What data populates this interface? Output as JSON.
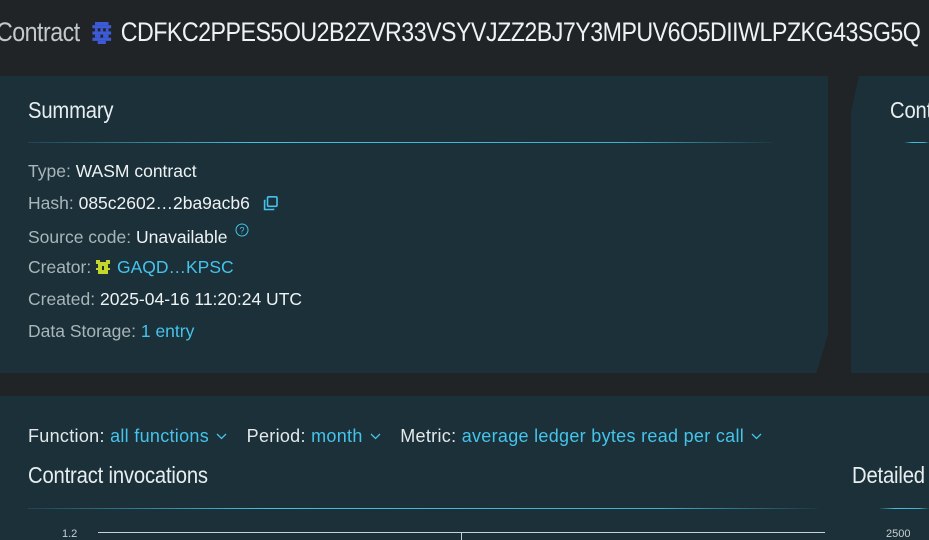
{
  "page_title": {
    "prefix": "Contract",
    "contract_id": "CDFKC2PPES5OU2B2ZVR33VSYVJZZ2BJ7Y3MPUV6O5DIIWLPZKG43SG5Q"
  },
  "summary": {
    "title": "Summary",
    "rows": [
      {
        "label": "Type:",
        "value": "WASM contract"
      },
      {
        "label": "Hash:",
        "value": "085c2602…2ba9acb6"
      },
      {
        "label": "Source code:",
        "value": "Unavailable"
      },
      {
        "label": "Creator:",
        "value": "GAQD…KPSC"
      },
      {
        "label": "Created:",
        "value": "2025-04-16 11:20:24 UTC"
      },
      {
        "label": "Data Storage:",
        "value": "1 entry"
      }
    ]
  },
  "side_panel": {
    "title": "Cont"
  },
  "filters": {
    "function_label": "Function:",
    "function_value": "all functions",
    "period_label": "Period:",
    "period_value": "month",
    "metric_label": "Metric:",
    "metric_value": "average ledger bytes read per call"
  },
  "invocations": {
    "title": "Contract invocations",
    "detailed_title": "Detailed"
  },
  "chart_data": {
    "type": "line",
    "title": "",
    "y_ticks_left": [
      "1.2"
    ],
    "y_ticks_right": [
      "2500"
    ]
  },
  "colors": {
    "background": "#212426",
    "panel": "#1b3038",
    "accent": "#45c3eb",
    "label": "#a8b6ba"
  },
  "icons": {
    "contract_identicon": "contract-identicon",
    "copy": "copy-icon",
    "help": "help-icon",
    "creator_identicon": "account-identicon",
    "dropdown": "chevron-down-icon"
  }
}
